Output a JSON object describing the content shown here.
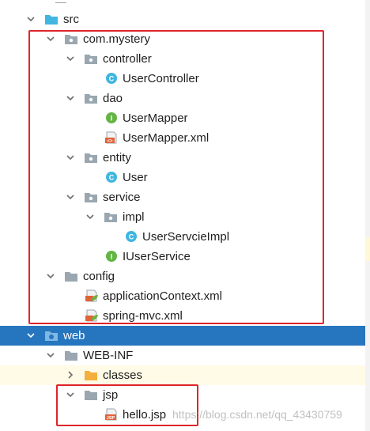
{
  "colors": {
    "selection": "#2675bf",
    "annotation_box": "#e0242b",
    "folder_gray": "#9aa7b0",
    "folder_blue": "#40b6e0",
    "folder_orange": "#f4af3d",
    "class_icon": "#40b6e0",
    "interface_icon": "#62b543",
    "xml_icon": "#e0633a"
  },
  "tree": [
    {
      "label": "src",
      "icon": "folder-blue-icon",
      "expanded": true,
      "selected": false
    },
    {
      "label": "com.mystery",
      "icon": "package-icon",
      "expanded": true,
      "selected": false
    },
    {
      "label": "controller",
      "icon": "package-icon",
      "expanded": true,
      "selected": false
    },
    {
      "label": "UserController",
      "icon": "class-icon",
      "expanded": null,
      "selected": false
    },
    {
      "label": "dao",
      "icon": "package-icon",
      "expanded": true,
      "selected": false
    },
    {
      "label": "UserMapper",
      "icon": "interface-icon",
      "expanded": null,
      "selected": false
    },
    {
      "label": "UserMapper.xml",
      "icon": "xml-file-icon",
      "expanded": null,
      "selected": false
    },
    {
      "label": "entity",
      "icon": "package-icon",
      "expanded": true,
      "selected": false
    },
    {
      "label": "User",
      "icon": "class-icon",
      "expanded": null,
      "selected": false
    },
    {
      "label": "service",
      "icon": "package-icon",
      "expanded": true,
      "selected": false
    },
    {
      "label": "impl",
      "icon": "package-icon",
      "expanded": true,
      "selected": false
    },
    {
      "label": "UserServcieImpl",
      "icon": "class-icon",
      "expanded": null,
      "selected": false
    },
    {
      "label": "IUserService",
      "icon": "interface-icon",
      "expanded": null,
      "selected": false
    },
    {
      "label": "config",
      "icon": "folder-icon",
      "expanded": true,
      "selected": false
    },
    {
      "label": "applicationContext.xml",
      "icon": "spring-xml-icon",
      "expanded": null,
      "selected": false
    },
    {
      "label": "spring-mvc.xml",
      "icon": "spring-xml-icon",
      "expanded": null,
      "selected": false
    },
    {
      "label": "web",
      "icon": "web-folder-icon",
      "expanded": true,
      "selected": true
    },
    {
      "label": "WEB-INF",
      "icon": "folder-icon",
      "expanded": true,
      "selected": false
    },
    {
      "label": "classes",
      "icon": "folder-orange-icon",
      "expanded": false,
      "selected": false
    },
    {
      "label": "jsp",
      "icon": "folder-icon",
      "expanded": true,
      "selected": false
    },
    {
      "label": "hello.jsp",
      "icon": "jsp-file-icon",
      "expanded": null,
      "selected": false
    }
  ],
  "watermark": "https://blog.csdn.net/qq_43430759"
}
